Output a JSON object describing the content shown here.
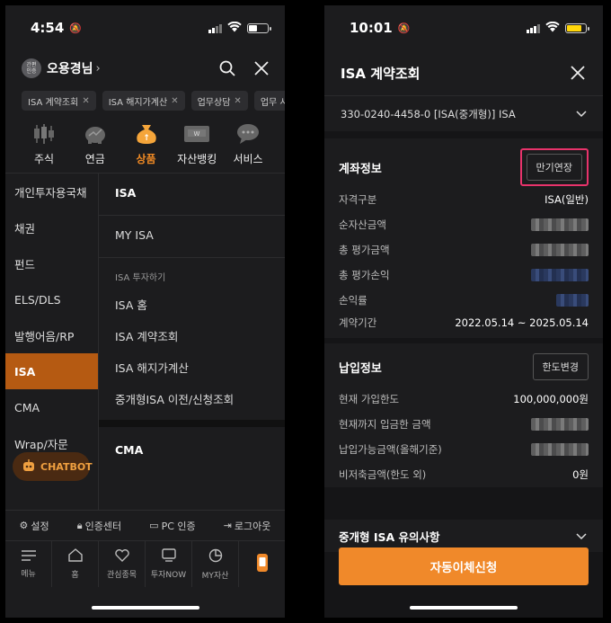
{
  "left": {
    "status": {
      "time": "4:54"
    },
    "user": {
      "avatar": [
        "간편",
        "인증"
      ],
      "name": "오용경님"
    },
    "chips": [
      "ISA 계약조회",
      "ISA 해지가계산",
      "업무상담",
      "업무 시"
    ],
    "categories": [
      {
        "label": "주식",
        "icon": "candlestick-icon"
      },
      {
        "label": "연금",
        "icon": "pig-bank-icon"
      },
      {
        "label": "상품",
        "icon": "money-bag-icon",
        "active": true
      },
      {
        "label": "자산뱅킹",
        "icon": "wallet-icon"
      },
      {
        "label": "서비스",
        "icon": "chat-bubble-icon"
      }
    ],
    "side_menu": [
      "개인투자용국채",
      "채권",
      "펀드",
      "ELS/DLS",
      "발행어음/RP",
      "ISA",
      "CMA",
      "Wrap/자문"
    ],
    "side_active_index": 5,
    "chatbot_label": "CHATBOT",
    "main_menu": {
      "isa_head": "ISA",
      "my_isa": "MY ISA",
      "isa_group_title": "ISA 투자하기",
      "isa_items": [
        "ISA 홈",
        "ISA 계약조회",
        "ISA 해지가계산",
        "중개형ISA 이전/신청조회"
      ],
      "cma_head": "CMA"
    },
    "footer_links": [
      "설정",
      "인증센터",
      "PC 인증",
      "로그아웃"
    ],
    "tabs": [
      "메뉴",
      "홈",
      "관심종목",
      "투자NOW",
      "MY자산",
      ""
    ]
  },
  "right": {
    "status": {
      "time": "10:01"
    },
    "title": "ISA 계약조회",
    "account": "330-0240-4458-0 [ISA(중개형)] ISA",
    "account_info": {
      "title": "계좌정보",
      "button": "만기연장",
      "rows": [
        {
          "k": "자격구분",
          "v": "ISA(일반)"
        },
        {
          "k": "순자산금액",
          "v": ""
        },
        {
          "k": "총 평가금액",
          "v": ""
        },
        {
          "k": "총 평가손익",
          "v": ""
        },
        {
          "k": "손익률",
          "v": ""
        },
        {
          "k": "계약기간",
          "v": "2022.05.14 ~ 2025.05.14"
        }
      ]
    },
    "payment_info": {
      "title": "납입정보",
      "button": "한도변경",
      "rows": [
        {
          "k": "현재 가입한도",
          "v": "100,000,000원"
        },
        {
          "k": "현재까지 입금한 금액",
          "v": ""
        },
        {
          "k": "납입가능금액(올해기준)",
          "v": ""
        },
        {
          "k": "비저축금액(한도 외)",
          "v": "0원"
        }
      ]
    },
    "notice": "중개형 ISA 유의사항",
    "cta": "자동이체신청"
  },
  "colors": {
    "accent": "#f0892a",
    "highlight": "#e8336b",
    "active_menu": "#b55a12"
  }
}
